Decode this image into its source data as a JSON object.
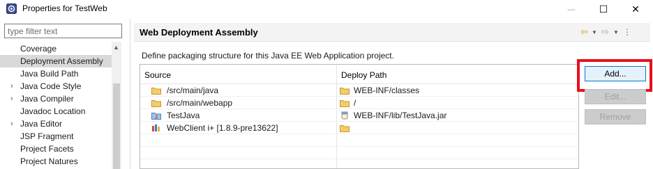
{
  "window": {
    "title": "Properties for TestWeb",
    "minimize_glyph": "—",
    "maximize_glyph": "☐",
    "close_glyph": "✕"
  },
  "filter": {
    "placeholder": "type filter text"
  },
  "tree": {
    "items": [
      {
        "label": "Coverage",
        "expandable": false,
        "selected": false
      },
      {
        "label": "Deployment Assembly",
        "expandable": false,
        "selected": true
      },
      {
        "label": "Java Build Path",
        "expandable": false,
        "selected": false
      },
      {
        "label": "Java Code Style",
        "expandable": true,
        "selected": false
      },
      {
        "label": "Java Compiler",
        "expandable": true,
        "selected": false
      },
      {
        "label": "Javadoc Location",
        "expandable": false,
        "selected": false
      },
      {
        "label": "Java Editor",
        "expandable": true,
        "selected": false
      },
      {
        "label": "JSP Fragment",
        "expandable": false,
        "selected": false
      },
      {
        "label": "Project Facets",
        "expandable": false,
        "selected": false
      },
      {
        "label": "Project Natures",
        "expandable": false,
        "selected": false
      }
    ]
  },
  "page": {
    "title": "Web Deployment Assembly",
    "description": "Define packaging structure for this Java EE Web Application project."
  },
  "table": {
    "columns": {
      "source": "Source",
      "deploy_path": "Deploy Path"
    },
    "rows": [
      {
        "source": "/src/main/java",
        "source_icon": "folder-icon",
        "deploy": "WEB-INF/classes",
        "deploy_icon": "folder-icon"
      },
      {
        "source": "/src/main/webapp",
        "source_icon": "folder-icon",
        "deploy": "/",
        "deploy_icon": "folder-icon"
      },
      {
        "source": "TestJava",
        "source_icon": "java-project-icon",
        "deploy": "WEB-INF/lib/TestJava.jar",
        "deploy_icon": "jar-icon"
      },
      {
        "source": "WebClient i+ [1.8.9-pre13622]",
        "source_icon": "library-icon",
        "deploy": "",
        "deploy_icon": "folder-icon"
      }
    ]
  },
  "buttons": {
    "add": "Add...",
    "edit": "Edit...",
    "remove": "Remove"
  },
  "colors": {
    "highlight": "#e8101b",
    "folder": "#e8b84a",
    "selection": "#d9d9d9"
  }
}
